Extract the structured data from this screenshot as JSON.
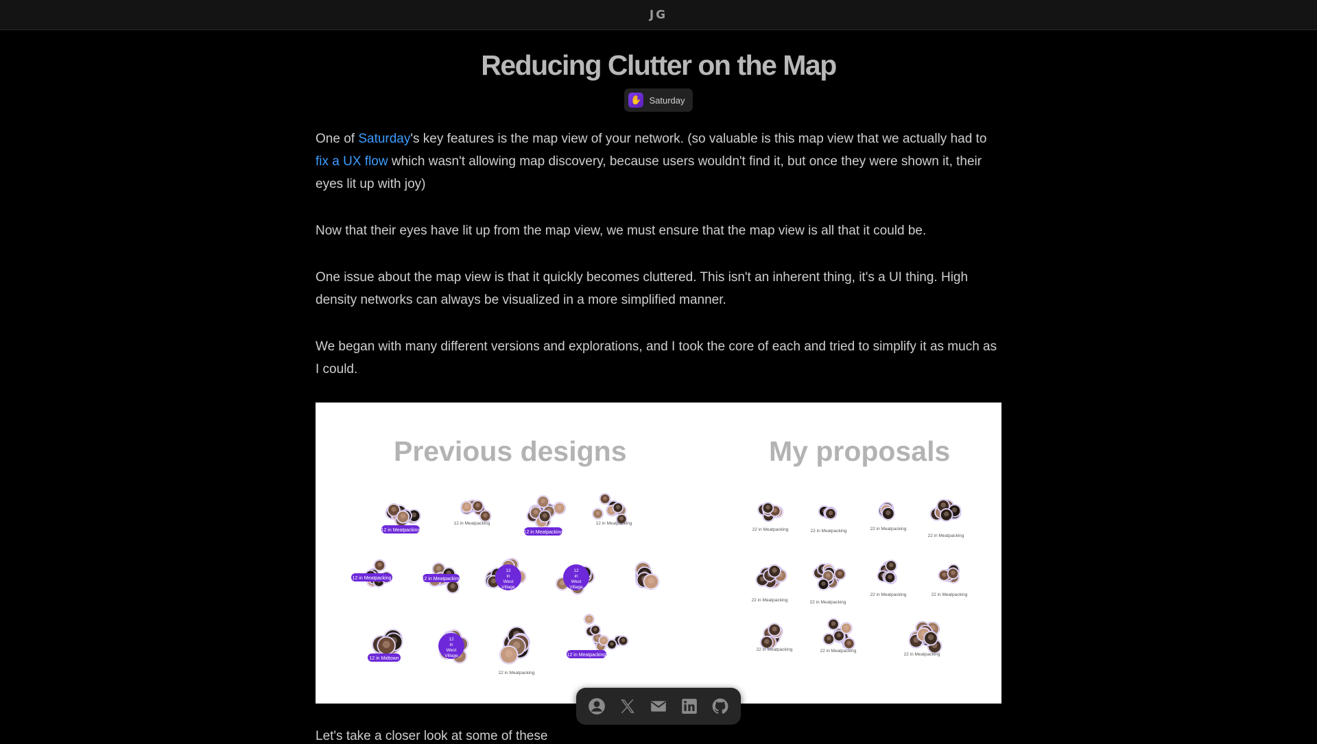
{
  "header": {
    "logo": "JG"
  },
  "article": {
    "title": "Reducing Clutter on the Map",
    "tag": {
      "label": "Saturday",
      "icon": "waving-hand-icon",
      "icon_color": "#7c3aed"
    },
    "p1": {
      "pre": "One of ",
      "link1": "Saturday",
      "mid": "'s key features is the map view of your network. (so valuable is this map view that we actually had to ",
      "link2": "fix a UX flow",
      "post": " which wasn't allowing map discovery, because users wouldn't find it, but once they were shown it, their eyes lit up with joy)"
    },
    "p2": "Now that their eyes have lit up from the map view, we must ensure that the map view is all that it could be.",
    "p3": "One issue about the map view is that it quickly becomes cluttered. This isn't an inherent thing, it's a UI thing. High density networks can always be visualized in a more simplified manner.",
    "p4": "We began with many different versions and explorations, and I took the core of each and tried to simplify it as much as I could.",
    "last": "Let's take a closer look at some of these",
    "link_color": "#3b9cff"
  },
  "figure": {
    "left_heading": "Previous designs",
    "right_heading": "My proposals",
    "cluster_label_12": "12 in Meatpacking",
    "cluster_label_22": "22 in Meatpacking",
    "cluster_label_midtown": "12 in Midtown",
    "cluster_label_wv": "12 in West Village",
    "accent": "#6d28d9"
  },
  "social": {
    "items": [
      {
        "name": "profile",
        "icon": "user-circle-icon"
      },
      {
        "name": "x",
        "icon": "x-logo-icon"
      },
      {
        "name": "email",
        "icon": "mail-icon"
      },
      {
        "name": "linkedin",
        "icon": "linkedin-icon"
      },
      {
        "name": "github",
        "icon": "github-icon"
      }
    ]
  }
}
